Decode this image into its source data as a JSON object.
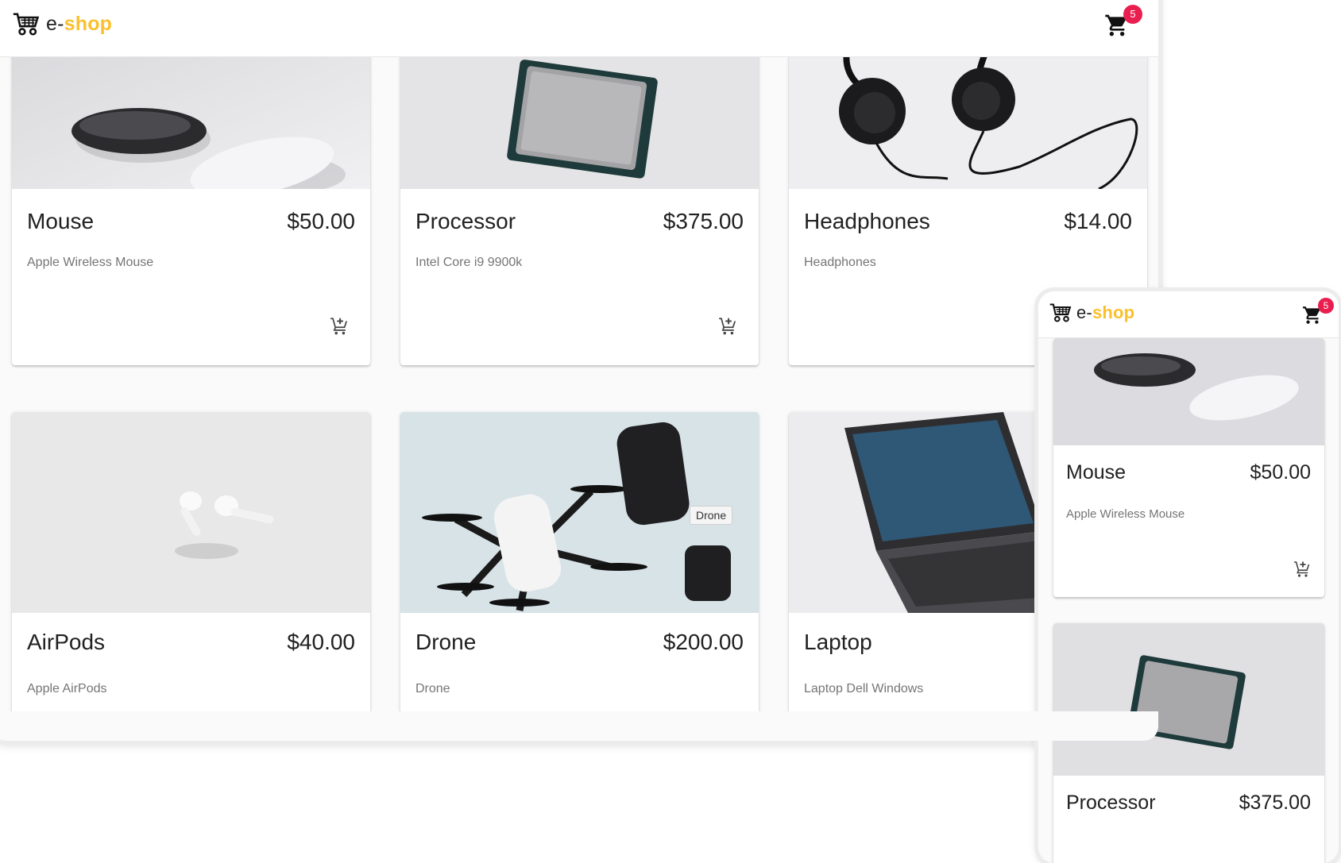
{
  "desktop": {
    "logo": {
      "prefix": "e-",
      "suffix": "shop",
      "icon": "cart-logo-icon"
    },
    "cart": {
      "icon": "shopping-cart-icon",
      "badge": "5"
    },
    "products": [
      {
        "title": "Mouse",
        "price": "$50.00",
        "description": "Apple Wireless Mouse",
        "image": "mouse-image"
      },
      {
        "title": "Processor",
        "price": "$375.00",
        "description": "Intel Core i9 9900k",
        "image": "processor-image"
      },
      {
        "title": "Headphones",
        "price": "$14.00",
        "description": "Headphones",
        "image": "headphones-image"
      },
      {
        "title": "AirPods",
        "price": "$40.00",
        "description": "Apple AirPods",
        "image": "airpods-image"
      },
      {
        "title": "Drone",
        "price": "$200.00",
        "description": "Drone",
        "image": "drone-image"
      },
      {
        "title": "Laptop",
        "price": "",
        "description": "Laptop Dell Windows",
        "image": "laptop-image"
      }
    ],
    "tooltip": "Drone",
    "colors": {
      "accent": "#fbc02d",
      "badge": "#e91e4f",
      "background": "#fafafa"
    }
  },
  "mobile": {
    "logo": {
      "prefix": "e-",
      "suffix": "shop"
    },
    "cart": {
      "badge": "5"
    },
    "products": [
      {
        "title": "Mouse",
        "price": "$50.00",
        "description": "Apple Wireless Mouse"
      },
      {
        "title": "Processor",
        "price": "$375.00",
        "description": ""
      }
    ]
  }
}
